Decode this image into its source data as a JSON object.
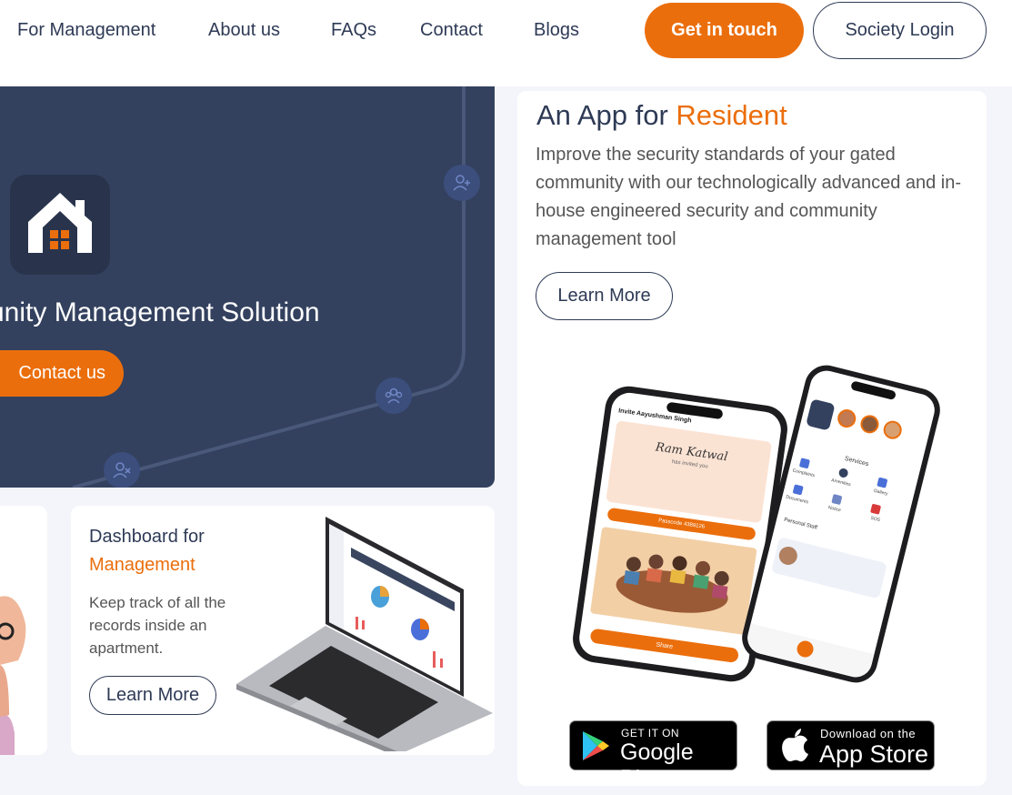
{
  "nav": {
    "links": [
      "For Management",
      "About us",
      "FAQs",
      "Contact",
      "Blogs"
    ],
    "get_in_touch": "Get in touch",
    "society_login": "Society Login"
  },
  "hero": {
    "title": "unity Management Solution",
    "contact_button": "Contact us"
  },
  "dashboard_card": {
    "title_line1": "Dashboard for",
    "title_line2": "Management",
    "description": "Keep track of all the records inside an apartment.",
    "button": "Learn More"
  },
  "resident_card": {
    "title_prefix": "An App for ",
    "title_accent": "Resident",
    "description": "Improve the security standards of your gated community with our technologically advanced and in-house engineered security and community management tool",
    "button": "Learn More",
    "phone1": {
      "header": "Invite Aayushman Singh",
      "name": "Ram Katwal",
      "subtitle": "has invited you",
      "passcode": "Passcode 4389126",
      "share": "Share"
    },
    "phone2": {
      "section": "Services",
      "services": [
        "Complaints",
        "Amenities",
        "Documents",
        "Notice",
        "SOS",
        "Gallery"
      ],
      "staff_label": "Personal Staff"
    },
    "google_play": {
      "small": "GET IT ON",
      "big": "Google Play"
    },
    "app_store": {
      "small": "Download on the",
      "big": "App Store"
    }
  },
  "colors": {
    "accent": "#eb6e0c",
    "navy": "#2e3a55",
    "hero_bg": "#33415f",
    "page_bg": "#f4f5fa"
  }
}
